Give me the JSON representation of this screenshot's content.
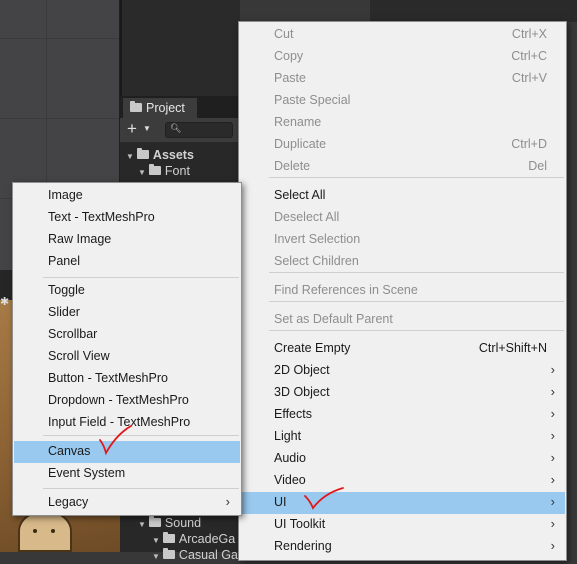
{
  "project_panel": {
    "tab_label": "Project",
    "tree": [
      {
        "label": "Assets",
        "bold": true
      },
      {
        "label": "Font",
        "bold": false
      },
      {
        "label": "Sound",
        "bold": false
      },
      {
        "label": "ArcadeGa",
        "bold": false
      },
      {
        "label": "Casual Ga",
        "bold": false
      }
    ]
  },
  "context_menu": {
    "items": [
      {
        "label": "Cut",
        "shortcut": "Ctrl+X",
        "enabled": false
      },
      {
        "label": "Copy",
        "shortcut": "Ctrl+C",
        "enabled": false
      },
      {
        "label": "Paste",
        "shortcut": "Ctrl+V",
        "enabled": false
      },
      {
        "label": "Paste Special",
        "shortcut": "",
        "enabled": false
      },
      {
        "label": "Rename",
        "shortcut": "",
        "enabled": false
      },
      {
        "label": "Duplicate",
        "shortcut": "Ctrl+D",
        "enabled": false
      },
      {
        "label": "Delete",
        "shortcut": "Del",
        "enabled": false
      },
      {
        "label": "Select All",
        "shortcut": "",
        "enabled": true
      },
      {
        "label": "Deselect All",
        "shortcut": "",
        "enabled": false
      },
      {
        "label": "Invert Selection",
        "shortcut": "",
        "enabled": false
      },
      {
        "label": "Select Children",
        "shortcut": "",
        "enabled": false
      },
      {
        "label": "Find References in Scene",
        "shortcut": "",
        "enabled": false
      },
      {
        "label": "Set as Default Parent",
        "shortcut": "",
        "enabled": false
      },
      {
        "label": "Create Empty",
        "shortcut": "Ctrl+Shift+N",
        "enabled": true
      },
      {
        "label": "2D Object",
        "shortcut": "",
        "enabled": true,
        "submenu": true
      },
      {
        "label": "3D Object",
        "shortcut": "",
        "enabled": true,
        "submenu": true
      },
      {
        "label": "Effects",
        "shortcut": "",
        "enabled": true,
        "submenu": true
      },
      {
        "label": "Light",
        "shortcut": "",
        "enabled": true,
        "submenu": true
      },
      {
        "label": "Audio",
        "shortcut": "",
        "enabled": true,
        "submenu": true
      },
      {
        "label": "Video",
        "shortcut": "",
        "enabled": true,
        "submenu": true
      },
      {
        "label": "UI",
        "shortcut": "",
        "enabled": true,
        "submenu": true,
        "highlighted": true
      },
      {
        "label": "UI Toolkit",
        "shortcut": "",
        "enabled": true,
        "submenu": true
      },
      {
        "label": "Rendering",
        "shortcut": "",
        "enabled": true,
        "submenu": true
      }
    ]
  },
  "ui_submenu": {
    "items": [
      {
        "label": "Image"
      },
      {
        "label": "Text - TextMeshPro"
      },
      {
        "label": "Raw Image"
      },
      {
        "label": "Panel"
      },
      {
        "label": "Toggle"
      },
      {
        "label": "Slider"
      },
      {
        "label": "Scrollbar"
      },
      {
        "label": "Scroll View"
      },
      {
        "label": "Button - TextMeshPro"
      },
      {
        "label": "Dropdown - TextMeshPro"
      },
      {
        "label": "Input Field - TextMeshPro"
      },
      {
        "label": "Canvas",
        "highlighted": true
      },
      {
        "label": "Event System"
      },
      {
        "label": "Legacy",
        "submenu": true
      }
    ]
  },
  "annotations": {
    "checkmark_color": "#e0191b",
    "highlight_color": "#99c9ef"
  }
}
